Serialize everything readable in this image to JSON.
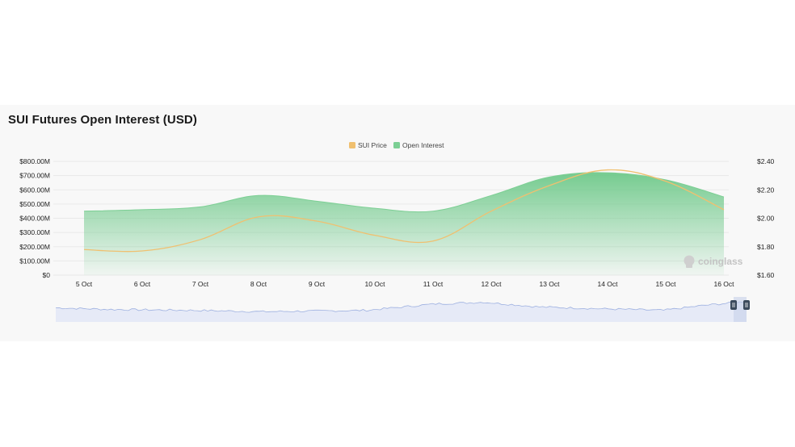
{
  "title": "SUI Futures Open Interest (USD)",
  "watermark": "coinglass",
  "colors": {
    "price": "#f0c070",
    "open_interest": "#7ccf94",
    "navigator_line": "#9db0e0",
    "navigator_fill": "#e6eaf7",
    "handle": "#3b4a5c"
  },
  "chart_data": {
    "type": "area",
    "legend": [
      "SUI Price",
      "Open Interest"
    ],
    "legend_position": "top-center",
    "grid": true,
    "x": [
      "5 Oct",
      "6 Oct",
      "7 Oct",
      "8 Oct",
      "9 Oct",
      "10 Oct",
      "11 Oct",
      "12 Oct",
      "13 Oct",
      "14 Oct",
      "15 Oct",
      "16 Oct"
    ],
    "y_left_ticks": [
      "$0",
      "$100.00M",
      "$200.00M",
      "$300.00M",
      "$400.00M",
      "$500.00M",
      "$600.00M",
      "$700.00M",
      "$800.00M"
    ],
    "y_left_range": [
      0,
      800
    ],
    "y_right_ticks": [
      "$1.60",
      "$1.80",
      "$2.00",
      "$2.20",
      "$2.40"
    ],
    "y_right_range": [
      1.6,
      2.4
    ],
    "series": [
      {
        "name": "Open Interest",
        "axis": "left",
        "unit": "M USD",
        "values": [
          450,
          460,
          480,
          560,
          520,
          470,
          450,
          560,
          690,
          720,
          670,
          550
        ]
      },
      {
        "name": "SUI Price",
        "axis": "right",
        "unit": "USD",
        "values": [
          1.78,
          1.77,
          1.85,
          2.01,
          1.98,
          1.88,
          1.84,
          2.05,
          2.23,
          2.34,
          2.26,
          2.06
        ]
      }
    ]
  }
}
